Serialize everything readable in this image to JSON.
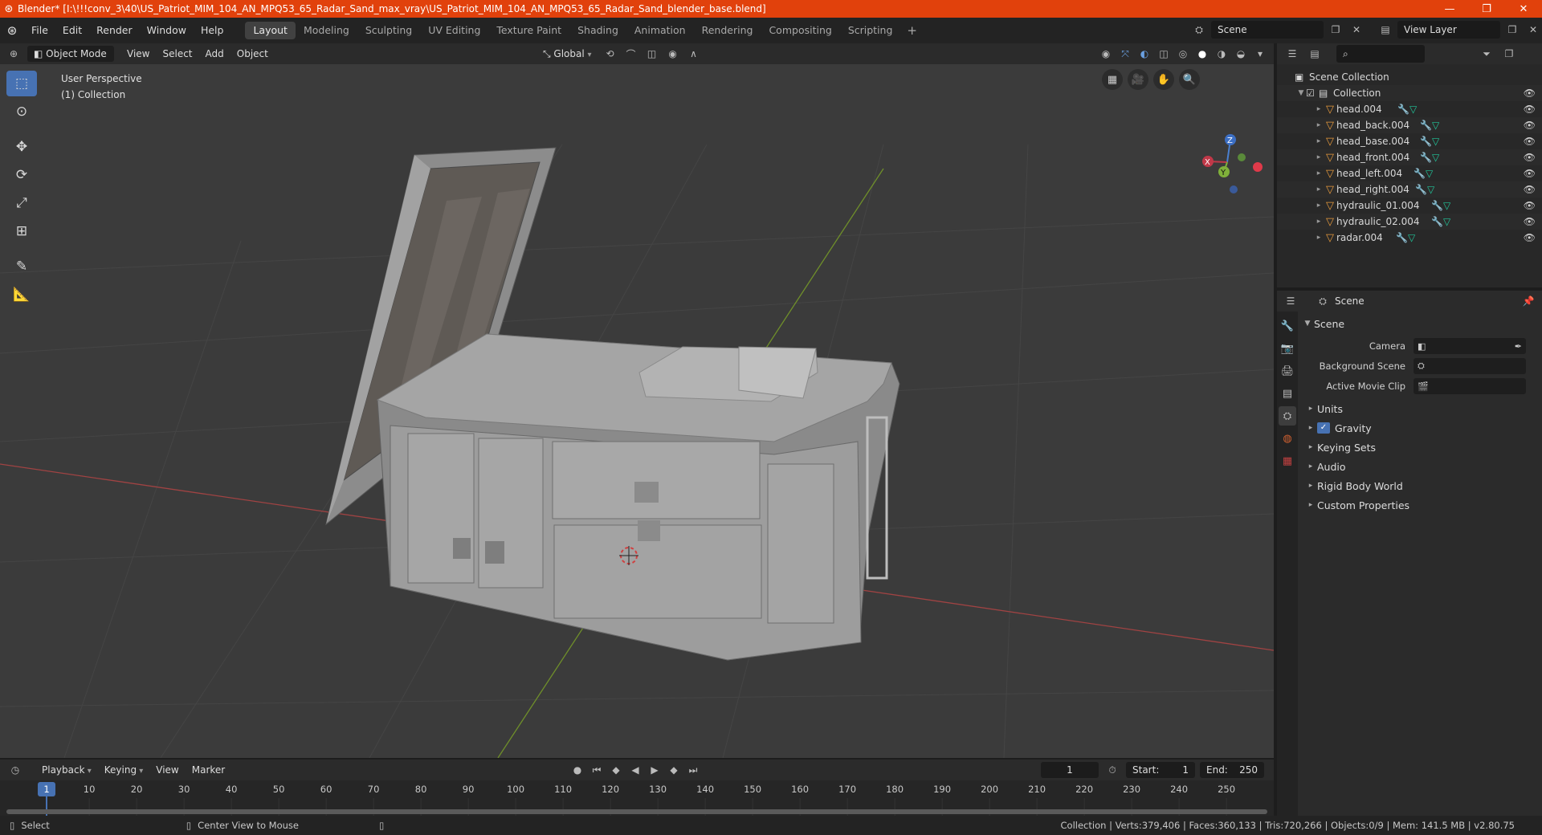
{
  "window": {
    "title": "Blender* [I:\\!!!conv_3\\40\\US_Patriot_MIM_104_AN_MPQ53_65_Radar_Sand_max_vray\\US_Patriot_MIM_104_AN_MPQ53_65_Radar_Sand_blender_base.blend]",
    "accent_color": "#e1410c"
  },
  "menu": {
    "items": [
      "File",
      "Edit",
      "Render",
      "Window",
      "Help"
    ]
  },
  "workspaces": {
    "tabs": [
      "Layout",
      "Modeling",
      "Sculpting",
      "UV Editing",
      "Texture Paint",
      "Shading",
      "Animation",
      "Rendering",
      "Compositing",
      "Scripting"
    ],
    "active": "Layout"
  },
  "scene_selector": {
    "value": "Scene"
  },
  "view_layer": {
    "value": "View Layer"
  },
  "viewport_header": {
    "mode": "Object Mode",
    "menus": [
      "View",
      "Select",
      "Add",
      "Object"
    ],
    "transform_orientation": "Global"
  },
  "viewport": {
    "perspective": "User Perspective",
    "collection": "(1) Collection",
    "gizmo": {
      "x": "X",
      "y": "Y",
      "z": "Z"
    },
    "active_tool_color": "#4772b3"
  },
  "outliner": {
    "root": "Scene Collection",
    "collection": "Collection",
    "objects": [
      {
        "name": "head.004"
      },
      {
        "name": "head_back.004"
      },
      {
        "name": "head_base.004"
      },
      {
        "name": "head_front.004"
      },
      {
        "name": "head_left.004"
      },
      {
        "name": "head_right.004"
      },
      {
        "name": "hydraulic_01.004"
      },
      {
        "name": "hydraulic_02.004"
      },
      {
        "name": "radar.004"
      }
    ]
  },
  "properties": {
    "context": "Scene",
    "panel_title": "Scene",
    "fields": [
      {
        "label": "Camera"
      },
      {
        "label": "Background Scene"
      },
      {
        "label": "Active Movie Clip"
      }
    ],
    "subpanels": [
      "Units",
      "Gravity",
      "Keying Sets",
      "Audio",
      "Rigid Body World",
      "Custom Properties"
    ],
    "gravity_checked": true
  },
  "timeline": {
    "menus": [
      "Playback",
      "Keying",
      "View",
      "Marker"
    ],
    "current_frame": "1",
    "start_label": "Start:",
    "start": "1",
    "end_label": "End:",
    "end": "250",
    "ruler": [
      "1",
      "10",
      "20",
      "30",
      "40",
      "50",
      "60",
      "70",
      "80",
      "90",
      "100",
      "110",
      "120",
      "130",
      "140",
      "150",
      "160",
      "170",
      "180",
      "190",
      "200",
      "210",
      "220",
      "230",
      "240",
      "250"
    ]
  },
  "statusbar": {
    "left_action": "Select",
    "middle_action": "Center View to Mouse",
    "stats": "Collection | Verts:379,406 | Faces:360,133 | Tris:720,266 | Objects:0/9 | Mem: 141.5 MB | v2.80.75"
  }
}
